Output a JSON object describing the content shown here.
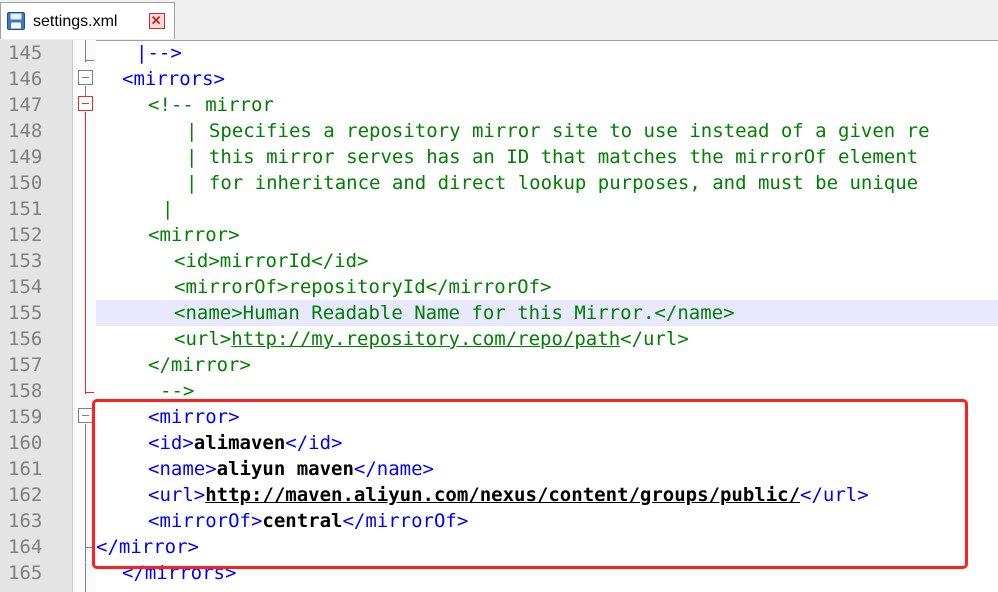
{
  "tab": {
    "filename": "settings.xml",
    "icon": "floppy-disk-icon",
    "close_icon": "close-tab-icon"
  },
  "lines": [
    {
      "num": "145",
      "segs": [
        {
          "t": "|-->",
          "c": "tg"
        }
      ]
    },
    {
      "num": "146",
      "segs": [
        {
          "t": "<mirrors>",
          "c": "tg"
        }
      ]
    },
    {
      "num": "147",
      "segs": [
        {
          "t": "<!-- mirror",
          "c": "cm"
        }
      ]
    },
    {
      "num": "148",
      "segs": [
        {
          "t": "| Specifies a repository mirror site to use instead of a given re",
          "c": "cm"
        }
      ]
    },
    {
      "num": "149",
      "segs": [
        {
          "t": "| this mirror serves has an ID that matches the mirrorOf element",
          "c": "cm"
        }
      ]
    },
    {
      "num": "150",
      "segs": [
        {
          "t": "| for inheritance and direct lookup purposes, and must be unique",
          "c": "cm"
        }
      ]
    },
    {
      "num": "151",
      "segs": [
        {
          "t": "|",
          "c": "cm"
        }
      ]
    },
    {
      "num": "152",
      "segs": [
        {
          "t": "<mirror>",
          "c": "cm"
        }
      ]
    },
    {
      "num": "153",
      "segs": [
        {
          "t": "<id>mirrorId</id>",
          "c": "cm"
        }
      ]
    },
    {
      "num": "154",
      "segs": [
        {
          "t": "<mirrorOf>repositoryId</mirrorOf>",
          "c": "cm"
        }
      ]
    },
    {
      "num": "155",
      "segs": [
        {
          "t": "<name>Human Readable Name for this Mirror.</name>",
          "c": "cm"
        }
      ]
    },
    {
      "num": "156",
      "segs": [
        {
          "t": "<url>",
          "c": "cm"
        },
        {
          "t": "http://my.repository.com/repo/path",
          "c": "cm u"
        },
        {
          "t": "</url>",
          "c": "cm"
        }
      ]
    },
    {
      "num": "157",
      "segs": [
        {
          "t": "</mirror>",
          "c": "cm"
        }
      ]
    },
    {
      "num": "158",
      "segs": [
        {
          "t": "-->",
          "c": "cm"
        }
      ]
    },
    {
      "num": "159",
      "segs": [
        {
          "t": "<mirror>",
          "c": "tg"
        }
      ]
    },
    {
      "num": "160",
      "segs": [
        {
          "t": "<id>",
          "c": "tg"
        },
        {
          "t": "alimaven",
          "c": "bl b"
        },
        {
          "t": "</id>",
          "c": "tg"
        }
      ]
    },
    {
      "num": "161",
      "segs": [
        {
          "t": "<name>",
          "c": "tg"
        },
        {
          "t": "aliyun maven",
          "c": "bl b"
        },
        {
          "t": "</name>",
          "c": "tg"
        }
      ]
    },
    {
      "num": "162",
      "segs": [
        {
          "t": "<url>",
          "c": "tg"
        },
        {
          "t": "http://maven.aliyun.com/nexus/content/groups/public/",
          "c": "bl b u"
        },
        {
          "t": "</url>",
          "c": "tg"
        }
      ]
    },
    {
      "num": "163",
      "segs": [
        {
          "t": "<mirrorOf>",
          "c": "tg"
        },
        {
          "t": "central",
          "c": "bl b"
        },
        {
          "t": "</mirrorOf>",
          "c": "tg"
        }
      ]
    },
    {
      "num": "164",
      "segs": [
        {
          "t": "</mirror>",
          "c": "tg"
        }
      ]
    },
    {
      "num": "165",
      "segs": [
        {
          "t": "</mirrors>",
          "c": "tg"
        }
      ]
    }
  ],
  "highlighted_line": "155",
  "selection_color": "#ff1f1f"
}
